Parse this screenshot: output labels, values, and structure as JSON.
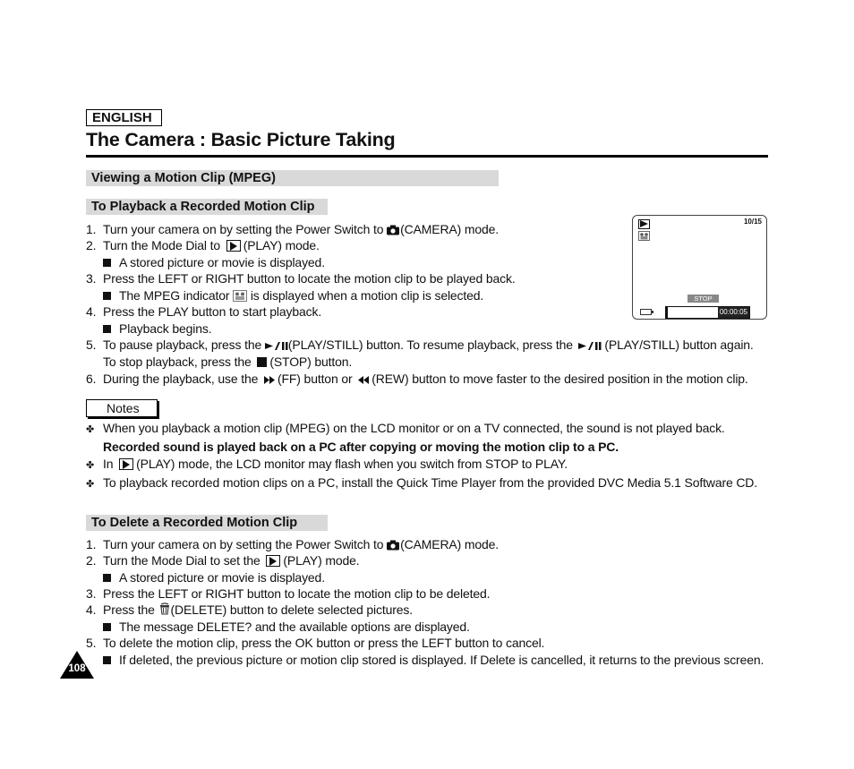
{
  "header": {
    "language": "ENGLISH",
    "title": "The Camera : Basic Picture Taking"
  },
  "section": {
    "title": "Viewing a Motion Clip (MPEG)"
  },
  "playback": {
    "title": "To Playback a Recorded Motion Clip",
    "steps": [
      {
        "num": "1.",
        "pre": "Turn your camera on by setting the Power Switch to ",
        "icon": "camera-icon",
        "post": "(CAMERA) mode."
      },
      {
        "num": "2.",
        "pre": "Turn the Mode Dial to ",
        "icon": "play-mode-icon",
        "post": "(PLAY) mode."
      },
      {
        "sub": "A stored picture or movie is displayed."
      },
      {
        "num": "3.",
        "text": "Press the LEFT or RIGHT button to locate the motion clip to be played back."
      },
      {
        "sub_pre": "The MPEG indicator ",
        "icon": "mpeg-indicator-icon",
        "sub_post": " is displayed when a motion clip is selected."
      },
      {
        "num": "4.",
        "text": "Press the PLAY button to start playback."
      },
      {
        "sub": "Playback begins."
      },
      {
        "num": "5.",
        "pre": "To pause playback, press the ",
        "icon": "play-still-icon",
        "mid": "(PLAY/STILL) button. To resume playback, press the ",
        "icon2": "play-still-icon",
        "post": " (PLAY/STILL) button again."
      },
      {
        "cont_pre": "To stop playback, press the ",
        "icon": "stop-icon",
        "cont_post": "(STOP) button."
      },
      {
        "num": "6.",
        "pre": "During the playback, use the ",
        "icon": "fast-forward-icon",
        "mid": "(FF) button or ",
        "icon2": "rewind-icon",
        "post": "(REW) button to move faster to the desired position in the motion clip."
      }
    ]
  },
  "notes": {
    "label": "Notes",
    "items": [
      {
        "text": "When you playback a motion clip (MPEG) on the LCD monitor or on a TV connected, the sound is not played back.",
        "bold": "Recorded sound is played back on a PC after copying or moving the motion clip to a PC."
      },
      {
        "pre": "In ",
        "icon": "play-mode-icon",
        "post": "(PLAY) mode, the LCD monitor may flash when you switch from STOP to PLAY."
      },
      {
        "text": "To playback recorded motion clips on a PC, install the Quick Time Player from the provided DVC Media 5.1 Software CD."
      }
    ]
  },
  "lcd": {
    "counter": "10/15",
    "status": "STOP",
    "timecode": "00:00:05",
    "progress_fraction": 0.02,
    "icons": [
      "play-mode-icon",
      "mpeg-indicator-icon",
      "battery-icon"
    ]
  },
  "delete": {
    "title": "To Delete a Recorded Motion Clip",
    "steps": [
      {
        "num": "1.",
        "pre": "Turn your camera on by setting the Power Switch to ",
        "icon": "camera-icon",
        "post": "(CAMERA) mode."
      },
      {
        "num": "2.",
        "pre": "Turn the Mode Dial to set the ",
        "icon": "play-mode-icon",
        "post": "(PLAY) mode."
      },
      {
        "sub": "A stored picture or movie is displayed."
      },
      {
        "num": "3.",
        "text": "Press the LEFT or RIGHT button to locate the motion clip to be deleted."
      },
      {
        "num": "4.",
        "pre": "Press the ",
        "icon": "trash-icon",
        "post": "(DELETE) button to delete selected pictures."
      },
      {
        "sub": "The message  DELETE?  and the available options are displayed."
      },
      {
        "num": "5.",
        "text": "To delete the motion clip, press the OK button or press the LEFT button to cancel."
      },
      {
        "sub": "If deleted, the previous picture or motion clip stored is displayed. If Delete is cancelled, it returns to the previous screen."
      }
    ]
  },
  "footer": {
    "page_number": "108"
  }
}
